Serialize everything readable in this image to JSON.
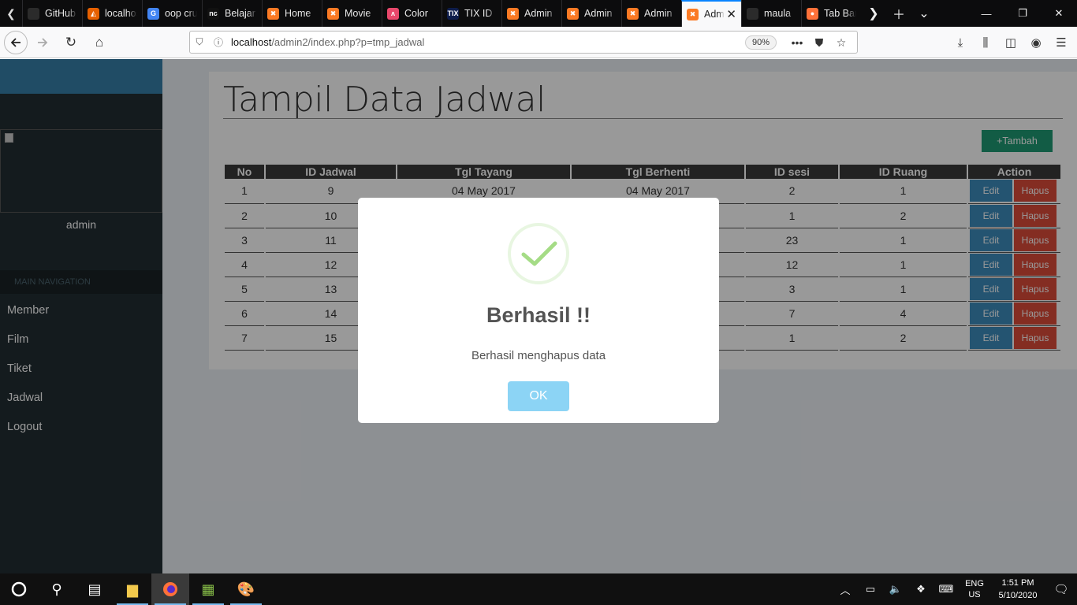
{
  "browser": {
    "tabs": [
      {
        "label": "GitHub",
        "fav": "",
        "color": "#2b2b2b"
      },
      {
        "label": "localhost",
        "fav": "◭",
        "color": "#e66000"
      },
      {
        "label": "oop crud",
        "fav": "G",
        "color": "#4285f4"
      },
      {
        "label": "Belajar",
        "fav": "nc",
        "color": "#111111"
      },
      {
        "label": "Home",
        "fav": "✖",
        "color": "#fb7a24"
      },
      {
        "label": "Movie",
        "fav": "✖",
        "color": "#fb7a24"
      },
      {
        "label": "Color",
        "fav": "ʌ",
        "color": "#e8476b"
      },
      {
        "label": "TIX ID",
        "fav": "TIX",
        "color": "#0e1d4b"
      },
      {
        "label": "Admin",
        "fav": "✖",
        "color": "#fb7a24"
      },
      {
        "label": "Admin",
        "fav": "✖",
        "color": "#fb7a24"
      },
      {
        "label": "Admin",
        "fav": "✖",
        "color": "#fb7a24"
      },
      {
        "label": "Admin",
        "fav": "✖",
        "color": "#fb7a24",
        "active": true
      },
      {
        "label": "maula",
        "fav": "",
        "color": "#2b2b2b"
      },
      {
        "label": "Tab Baru",
        "fav": "●",
        "color": "#ff7139"
      }
    ],
    "url_host": "localhost",
    "url_path": "/admin2/index.php?p=tmp_jadwal",
    "zoom": "90%"
  },
  "sidebar": {
    "username": "admin",
    "nav_header": "MAIN NAVIGATION",
    "items": [
      {
        "label": "Member"
      },
      {
        "label": "Film"
      },
      {
        "label": "Tiket"
      },
      {
        "label": "Jadwal"
      },
      {
        "label": "Logout"
      }
    ]
  },
  "main": {
    "title": "Tampil Data Jadwal",
    "add_button": "+Tambah",
    "columns": [
      "No",
      "ID Jadwal",
      "Tgl Tayang",
      "Tgl Berhenti",
      "ID sesi",
      "ID Ruang",
      "Action"
    ],
    "rows": [
      {
        "no": "1",
        "id_jadwal": "9",
        "tgl_tayang": "04 May 2017",
        "tgl_berhenti": "04 May 2017",
        "id_sesi": "2",
        "id_ruang": "1"
      },
      {
        "no": "2",
        "id_jadwal": "10",
        "tgl_tayang": "",
        "tgl_berhenti": "",
        "id_sesi": "1",
        "id_ruang": "2"
      },
      {
        "no": "3",
        "id_jadwal": "11",
        "tgl_tayang": "",
        "tgl_berhenti": "",
        "id_sesi": "23",
        "id_ruang": "1"
      },
      {
        "no": "4",
        "id_jadwal": "12",
        "tgl_tayang": "",
        "tgl_berhenti": "",
        "id_sesi": "12",
        "id_ruang": "1"
      },
      {
        "no": "5",
        "id_jadwal": "13",
        "tgl_tayang": "",
        "tgl_berhenti": "",
        "id_sesi": "3",
        "id_ruang": "1"
      },
      {
        "no": "6",
        "id_jadwal": "14",
        "tgl_tayang": "",
        "tgl_berhenti": "",
        "id_sesi": "7",
        "id_ruang": "4"
      },
      {
        "no": "7",
        "id_jadwal": "15",
        "tgl_tayang": "",
        "tgl_berhenti": "",
        "id_sesi": "1",
        "id_ruang": "2"
      }
    ],
    "edit_label": "Edit",
    "delete_label": "Hapus"
  },
  "modal": {
    "title": "Berhasil !!",
    "text": "Berhasil menghapus data",
    "ok_label": "OK",
    "icon": "success-check-icon"
  },
  "taskbar": {
    "lang_top": "ENG",
    "lang_bottom": "US",
    "time": "1:51 PM",
    "date": "5/10/2020"
  },
  "colors": {
    "sidebar_bg": "#222d32",
    "brand_blue": "#367fa9",
    "edit_blue": "#3c8dbc",
    "delete_red": "#dd4b39",
    "add_green": "#1e9a73",
    "ok_button": "#8cd4f5"
  }
}
